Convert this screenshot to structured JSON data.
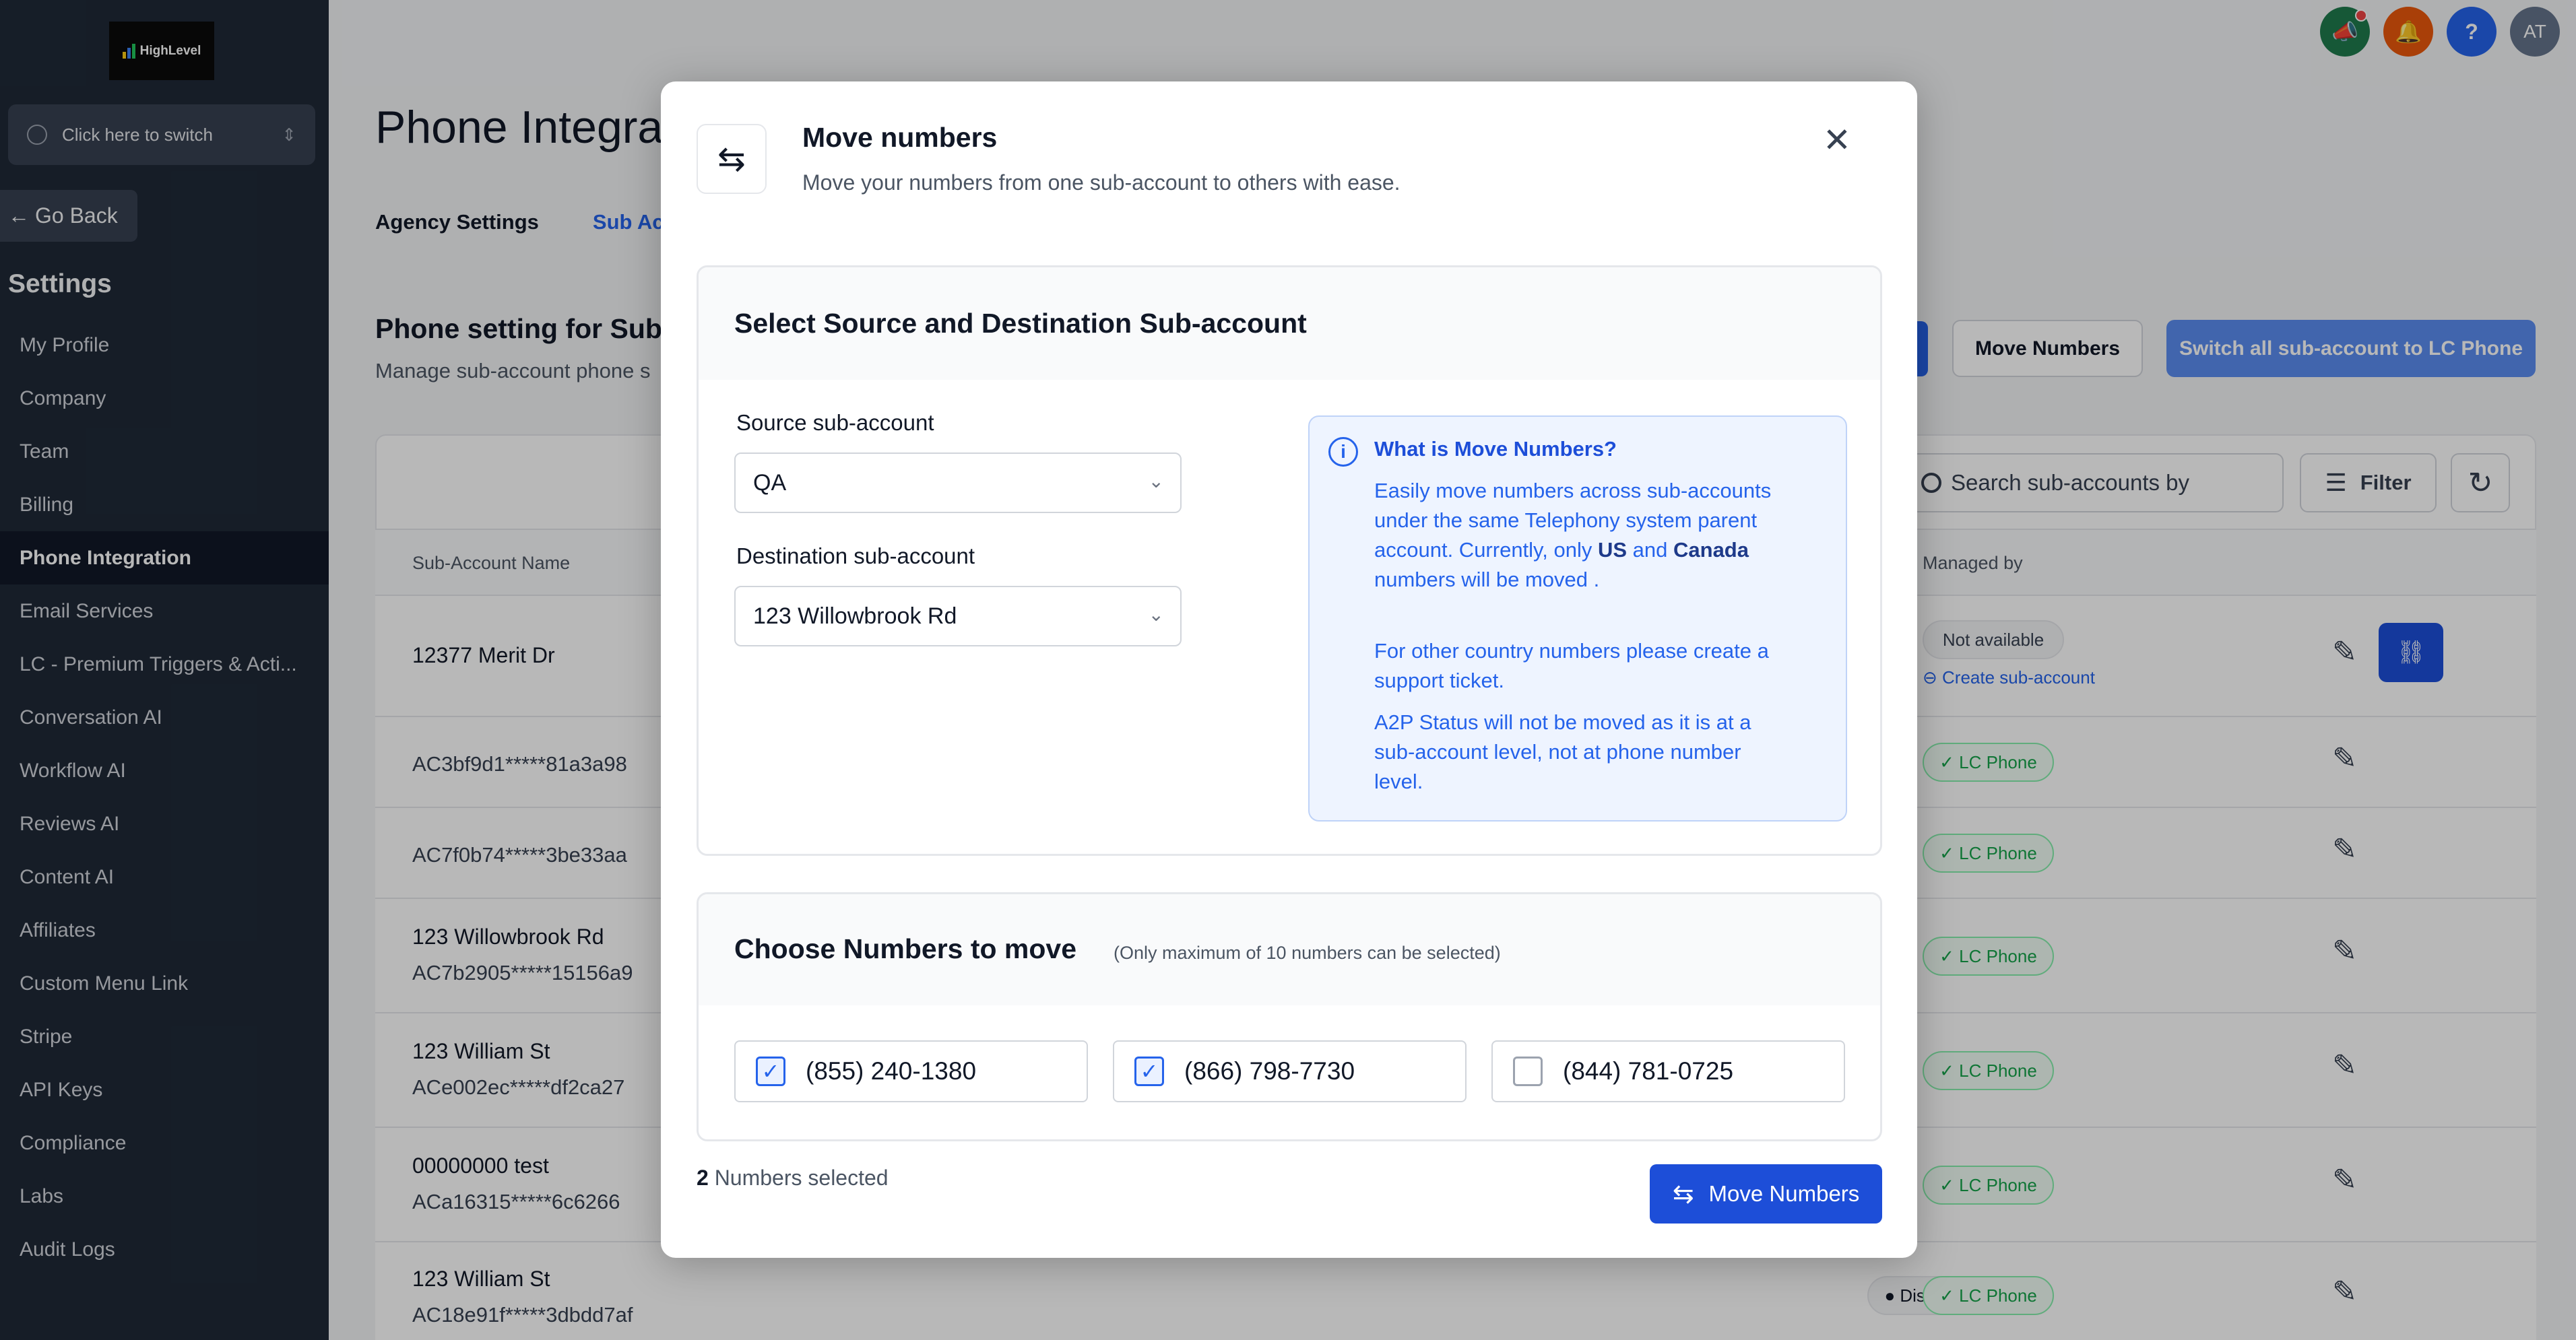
{
  "sidebar": {
    "logo_text": "HighLevel",
    "switcher_label": "Click here to switch",
    "go_back": "Go Back",
    "settings_title": "Settings",
    "items": [
      {
        "label": "My Profile"
      },
      {
        "label": "Company"
      },
      {
        "label": "Team"
      },
      {
        "label": "Billing"
      },
      {
        "label": "Phone Integration"
      },
      {
        "label": "Email Services"
      },
      {
        "label": "LC - Premium Triggers & Acti..."
      },
      {
        "label": "Conversation AI"
      },
      {
        "label": "Workflow AI"
      },
      {
        "label": "Reviews AI"
      },
      {
        "label": "Content AI"
      },
      {
        "label": "Affiliates"
      },
      {
        "label": "Custom Menu Link"
      },
      {
        "label": "Stripe"
      },
      {
        "label": "API Keys"
      },
      {
        "label": "Compliance"
      },
      {
        "label": "Labs"
      },
      {
        "label": "Audit Logs"
      }
    ]
  },
  "topbar": {
    "avatar_initials": "AT",
    "help_symbol": "?",
    "colors": {
      "announce": "#1f7a4d",
      "bell": "#ea580c",
      "help": "#2563eb",
      "avatar": "#64748b"
    }
  },
  "main": {
    "page_title": "Phone Integra",
    "tabs": [
      "Agency Settings",
      "Sub Acco"
    ],
    "section_title": "Phone setting for Sub-",
    "section_sub": "Manage sub-account phone s",
    "move_numbers_btn": "Move Numbers",
    "switch_all_btn": "Switch all sub-account to LC Phone",
    "search_placeholder": "Search sub-accounts by",
    "filter_label": "Filter",
    "columns": {
      "name": "Sub-Account Name",
      "managed_by": "Managed by"
    },
    "rows": [
      {
        "name": "12377 Merit Dr",
        "sid": "",
        "managed": "Not available",
        "link": "Create sub-account"
      },
      {
        "name": "",
        "sid": "AC3bf9d1*****81a3a98",
        "managed": "LC Phone"
      },
      {
        "name": "",
        "sid": "AC7f0b74*****3be33aa",
        "managed": "LC Phone"
      },
      {
        "name": "123 Willowbrook Rd",
        "sid": "AC7b2905*****15156a9",
        "managed": "LC Phone"
      },
      {
        "name": "123 William St",
        "sid": "ACe002ec*****df2ca27",
        "managed": "LC Phone"
      },
      {
        "name": "00000000 test",
        "sid": "ACa16315*****6c6266",
        "managed": "LC Phone"
      },
      {
        "name": "123 William St",
        "sid": "AC18e91f*****3dbdd7af",
        "managed": "LC Phone",
        "status": "Disabled"
      }
    ]
  },
  "modal": {
    "title": "Move numbers",
    "subtitle": "Move your numbers from one sub-account to others with ease.",
    "section1_title": "Select Source and Destination Sub-account",
    "source_label": "Source sub-account",
    "source_value": "QA",
    "dest_label": "Destination sub-account",
    "dest_value": "123 Willowbrook Rd",
    "info": {
      "title": "What is Move Numbers?",
      "p1_a": "Easily move numbers across sub-accounts under the same Telephony system parent account. Currently, only ",
      "p1_us": "US",
      "p1_and": " and ",
      "p1_ca": "Canada",
      "p1_b": " numbers will be moved .",
      "p2": "For other country numbers please create a support ticket.",
      "p3": "A2P Status will not be moved as it is at a sub-account level, not at phone number level."
    },
    "section2_title": "Choose Numbers to move",
    "section2_note": "(Only maximum of 10 numbers can be selected)",
    "numbers": [
      {
        "number": "(855) 240-1380",
        "checked": true
      },
      {
        "number": "(866) 798-7730",
        "checked": true
      },
      {
        "number": "(844) 781-0725",
        "checked": false
      }
    ],
    "selected_count": "2",
    "selected_label": "Numbers selected",
    "move_button": "Move Numbers"
  }
}
